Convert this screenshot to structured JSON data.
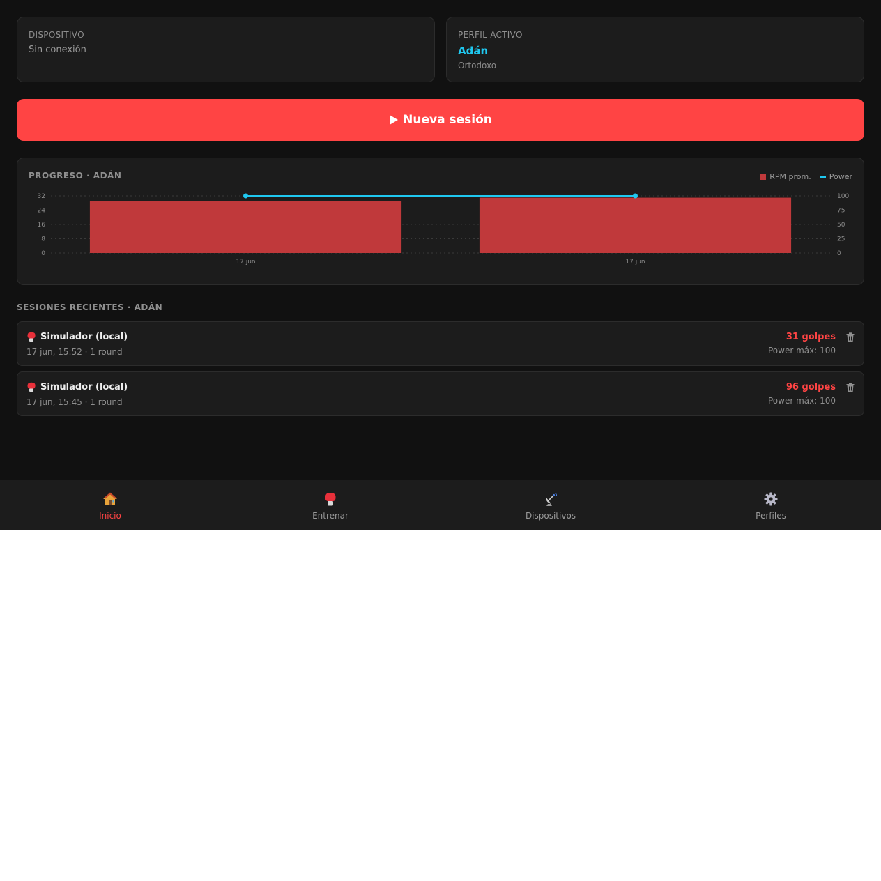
{
  "device": {
    "label": "DISPOSITIVO",
    "status": "Sin conexión"
  },
  "profile": {
    "label": "PERFIL ACTIVO",
    "name": "Adán",
    "stance": "Ortodoxo"
  },
  "new_session": {
    "icon": "play-icon",
    "label": "Nueva sesión"
  },
  "progress": {
    "title": "PROGRESO · ADÁN",
    "legend": [
      "RPM prom.",
      "Power"
    ]
  },
  "chart_data": {
    "type": "bar",
    "categories": [
      "17 jun",
      "17 jun"
    ],
    "series": [
      {
        "name": "RPM prom.",
        "type": "bar",
        "axis": "left",
        "values": [
          29,
          31
        ],
        "color": "#c0393b"
      },
      {
        "name": "Power",
        "type": "line",
        "axis": "right",
        "values": [
          100,
          100
        ],
        "color": "#1fc8f0"
      }
    ],
    "y_left": {
      "ticks": [
        0,
        8,
        16,
        24,
        32
      ],
      "ylim": [
        0,
        32
      ]
    },
    "y_right": {
      "ticks": [
        0,
        25,
        50,
        75,
        100
      ],
      "ylim": [
        0,
        100
      ]
    },
    "grid": true,
    "legend_position": "top-right"
  },
  "recent": {
    "title": "SESIONES RECIENTES · ADÁN",
    "sessions": [
      {
        "icon": "boxing-glove-icon",
        "name": "Simulador (local)",
        "meta": "17 jun, 15:52 · 1 round",
        "hits": "31 golpes",
        "power": "Power máx: 100"
      },
      {
        "icon": "boxing-glove-icon",
        "name": "Simulador (local)",
        "meta": "17 jun, 15:45 · 1 round",
        "hits": "96 golpes",
        "power": "Power máx: 100"
      }
    ]
  },
  "nav": {
    "items": [
      {
        "label": "Inicio",
        "icon": "home-icon",
        "active": true
      },
      {
        "label": "Entrenar",
        "icon": "boxing-glove-icon",
        "active": false
      },
      {
        "label": "Dispositivos",
        "icon": "satellite-antenna-icon",
        "active": false
      },
      {
        "label": "Perfiles",
        "icon": "gear-icon",
        "active": false
      }
    ]
  },
  "colors": {
    "accent": "#ff4444",
    "profile": "#1fc8f0",
    "bar": "#c0393b",
    "background": "#111111",
    "card": "#1c1c1c"
  }
}
